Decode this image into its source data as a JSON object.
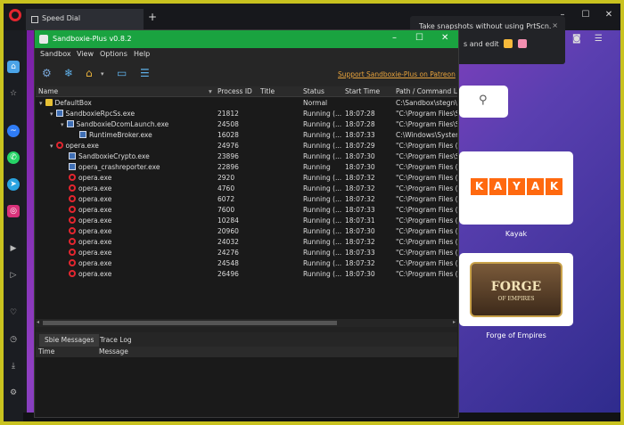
{
  "opera": {
    "tab_label": "Speed Dial",
    "new_tab": "+",
    "window_buttons": [
      "–",
      "☐",
      "✕"
    ],
    "notification": {
      "line1": "Take snapshots without using PrtScn.",
      "line2": "s and edit",
      "close": "×"
    },
    "speed_dial": [
      {
        "label": "Kayak",
        "logo_letters": [
          "K",
          "A",
          "Y",
          "A",
          "K"
        ]
      },
      {
        "label": "Forge of Empires",
        "logo_text": "FORGE",
        "logo_sub": "OF EMPIRES"
      }
    ],
    "sidebar_icons": [
      "home-icon",
      "star-icon",
      "messenger-icon",
      "whatsapp-icon",
      "telegram-icon",
      "instagram-icon",
      "player-icon",
      "send-icon",
      "heart-icon",
      "history-icon",
      "download-icon",
      "settings-icon"
    ]
  },
  "sandboxie": {
    "title": "Sandboxie-Plus v0.8.2",
    "window_buttons": [
      "–",
      "☐",
      "✕"
    ],
    "menu": [
      "Sandbox",
      "View",
      "Options",
      "Help"
    ],
    "support_link": "Support Sandboxie-Plus on Patreon",
    "columns": [
      "Name",
      "Process ID",
      "Title",
      "Status",
      "Start Time",
      "Path / Command Li"
    ],
    "rows": [
      {
        "indent": 0,
        "caret": "▾",
        "icon": "box",
        "name": "DefaultBox",
        "pid": "",
        "title": "",
        "status": "Normal",
        "time": "",
        "path": "C:\\Sandbox\\stegn\\"
      },
      {
        "indent": 1,
        "caret": "▾",
        "icon": "exe",
        "name": "SandboxieRpcSs.exe",
        "pid": "21812",
        "title": "",
        "status": "Running (...",
        "time": "18:07:28",
        "path": "\"C:\\Program Files\\S"
      },
      {
        "indent": 2,
        "caret": "▾",
        "icon": "exe",
        "name": "SandboxieDcomLaunch.exe",
        "pid": "24508",
        "title": "",
        "status": "Running (...",
        "time": "18:07:28",
        "path": "\"C:\\Program Files\\S"
      },
      {
        "indent": 3,
        "caret": "",
        "icon": "exe",
        "name": "RuntimeBroker.exe",
        "pid": "16028",
        "title": "",
        "status": "Running (...",
        "time": "18:07:33",
        "path": "C:\\Windows\\Syster"
      },
      {
        "indent": 1,
        "caret": "▾",
        "icon": "opera",
        "name": "opera.exe",
        "pid": "24976",
        "title": "",
        "status": "Running (...",
        "time": "18:07:29",
        "path": "\"C:\\Program Files (x"
      },
      {
        "indent": 2,
        "caret": "",
        "icon": "exe",
        "name": "SandboxieCrypto.exe",
        "pid": "23896",
        "title": "",
        "status": "Running (...",
        "time": "18:07:30",
        "path": "\"C:\\Program Files\\S"
      },
      {
        "indent": 2,
        "caret": "",
        "icon": "exe",
        "name": "opera_crashreporter.exe",
        "pid": "22896",
        "title": "",
        "status": "Running",
        "time": "18:07:30",
        "path": "\"C:\\Program Files (x"
      },
      {
        "indent": 2,
        "caret": "",
        "icon": "opera",
        "name": "opera.exe",
        "pid": "2920",
        "title": "",
        "status": "Running (...",
        "time": "18:07:32",
        "path": "\"C:\\Program Files (x"
      },
      {
        "indent": 2,
        "caret": "",
        "icon": "opera",
        "name": "opera.exe",
        "pid": "4760",
        "title": "",
        "status": "Running (...",
        "time": "18:07:32",
        "path": "\"C:\\Program Files (x"
      },
      {
        "indent": 2,
        "caret": "",
        "icon": "opera",
        "name": "opera.exe",
        "pid": "6072",
        "title": "",
        "status": "Running (...",
        "time": "18:07:32",
        "path": "\"C:\\Program Files (x"
      },
      {
        "indent": 2,
        "caret": "",
        "icon": "opera",
        "name": "opera.exe",
        "pid": "7600",
        "title": "",
        "status": "Running (...",
        "time": "18:07:33",
        "path": "\"C:\\Program Files (x"
      },
      {
        "indent": 2,
        "caret": "",
        "icon": "opera",
        "name": "opera.exe",
        "pid": "10284",
        "title": "",
        "status": "Running (...",
        "time": "18:07:31",
        "path": "\"C:\\Program Files (x"
      },
      {
        "indent": 2,
        "caret": "",
        "icon": "opera",
        "name": "opera.exe",
        "pid": "20960",
        "title": "",
        "status": "Running (...",
        "time": "18:07:30",
        "path": "\"C:\\Program Files (x"
      },
      {
        "indent": 2,
        "caret": "",
        "icon": "opera",
        "name": "opera.exe",
        "pid": "24032",
        "title": "",
        "status": "Running (...",
        "time": "18:07:32",
        "path": "\"C:\\Program Files (x"
      },
      {
        "indent": 2,
        "caret": "",
        "icon": "opera",
        "name": "opera.exe",
        "pid": "24276",
        "title": "",
        "status": "Running (...",
        "time": "18:07:33",
        "path": "\"C:\\Program Files (x"
      },
      {
        "indent": 2,
        "caret": "",
        "icon": "opera",
        "name": "opera.exe",
        "pid": "24548",
        "title": "",
        "status": "Running (...",
        "time": "18:07:32",
        "path": "\"C:\\Program Files (x"
      },
      {
        "indent": 2,
        "caret": "",
        "icon": "opera",
        "name": "opera.exe",
        "pid": "26496",
        "title": "",
        "status": "Running (...",
        "time": "18:07:30",
        "path": "\"C:\\Program Files (x"
      }
    ],
    "bottom_tabs": [
      "Sbie Messages",
      "Trace Log"
    ],
    "message_columns": [
      "Time",
      "Message"
    ]
  },
  "colors": {
    "titlebar": "#1aa340",
    "accent_link": "#e8a33c",
    "opera_red": "#e3262f",
    "frame": "#c9c21f"
  }
}
